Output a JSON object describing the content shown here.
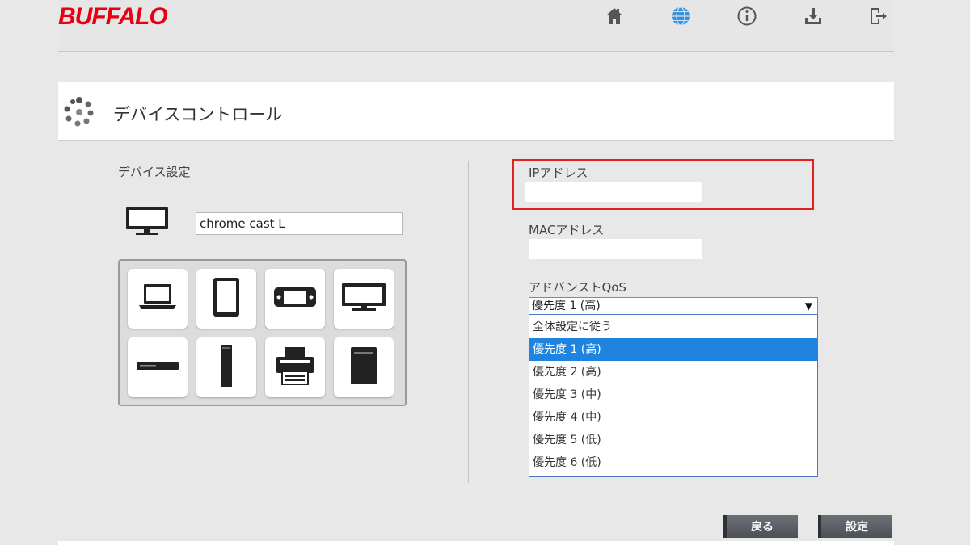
{
  "header": {
    "logo_text": "BUFFALO",
    "brand_color": "#e60012",
    "icons": [
      "home-icon",
      "globe-icon",
      "info-icon",
      "download-icon",
      "logout-icon"
    ]
  },
  "page": {
    "title": "デバイスコントロール"
  },
  "device_settings": {
    "label": "デバイス設定",
    "device_name": "chrome cast L",
    "device_types": [
      "laptop-icon",
      "tablet-icon",
      "game-console-icon",
      "tv-icon",
      "set-top-box-icon",
      "tower-pc-icon",
      "printer-icon",
      "nas-icon"
    ]
  },
  "network": {
    "ip_label": "IPアドレス",
    "ip_value": "",
    "mac_label": "MACアドレス",
    "mac_value": "",
    "highlight_color": "#e32020"
  },
  "qos": {
    "label": "アドバンストQoS",
    "selected_display": "優先度 1 (高)",
    "options": [
      "全体設定に従う",
      "優先度 1 (高)",
      "優先度 2 (高)",
      "優先度 3 (中)",
      "優先度 4 (中)",
      "優先度 5 (低)",
      "優先度 6 (低)"
    ],
    "highlighted_option": "優先度 1 (高)",
    "highlight_color": "#1e84e0"
  },
  "buttons": {
    "back": "戻る",
    "apply": "設定"
  }
}
